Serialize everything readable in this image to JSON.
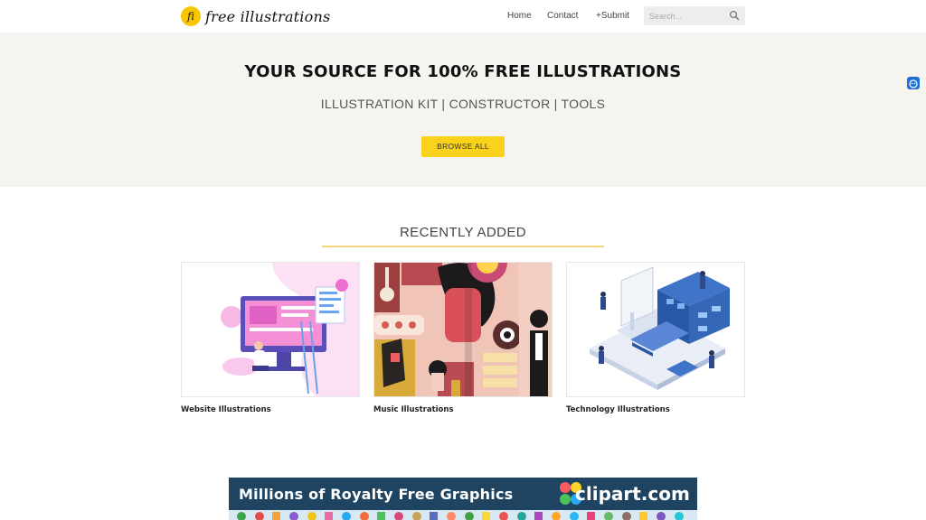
{
  "header": {
    "logo_mark": "fi",
    "logo_text": "free illustrations",
    "nav": {
      "home": "Home",
      "contact": "Contact",
      "submit": "+Submit"
    },
    "search": {
      "placeholder": "Search..."
    }
  },
  "hero": {
    "title": "YOUR SOURCE FOR 100% FREE ILLUSTRATIONS",
    "subtitle": "ILLUSTRATION KIT | CONSTRUCTOR | TOOLS",
    "button_label": "BROWSE ALL"
  },
  "recent": {
    "title": "RECENTLY ADDED",
    "cards": [
      {
        "label": "Website Illustrations"
      },
      {
        "label": "Music Illustrations"
      },
      {
        "label": "Technology Illustrations"
      }
    ]
  },
  "banner": {
    "text": "Millions of Royalty Free Graphics",
    "brand": "clipart.com"
  },
  "colors": {
    "accent_yellow": "#f9d21c",
    "hero_bg": "#f5f4f0",
    "banner_navy": "#1e4462"
  }
}
